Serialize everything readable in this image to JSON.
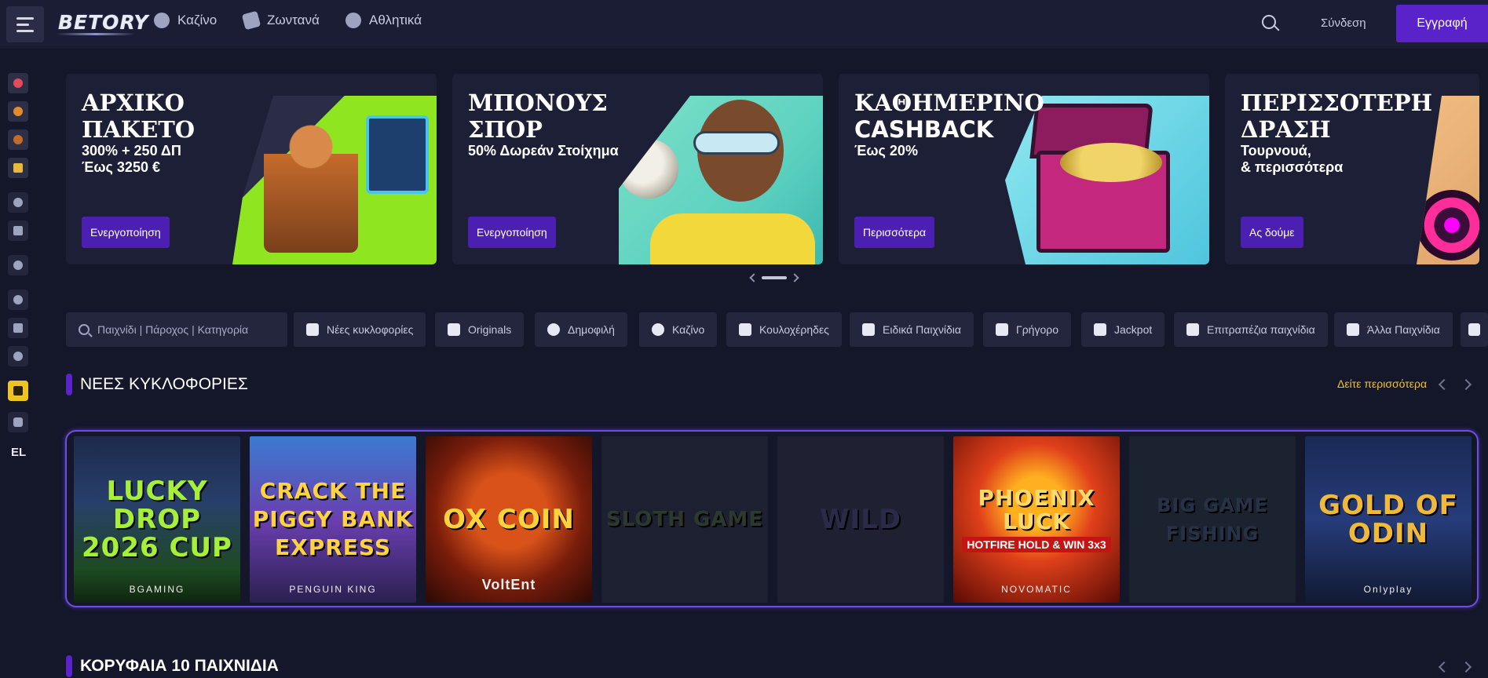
{
  "header": {
    "logo": "BETORY",
    "nav": [
      {
        "label": "Καζίνο",
        "icon": "casino-chip-icon"
      },
      {
        "label": "Ζωντανά",
        "icon": "live-dice-icon"
      },
      {
        "label": "Αθλητικά",
        "icon": "basketball-icon"
      }
    ],
    "login": "Σύνδεση",
    "register": "Εγγραφή"
  },
  "sidebar": {
    "items": [
      "crosshair-icon",
      "pizza-icon",
      "ball-icon",
      "trophy-icon",
      "casino-chip-icon",
      "dice-icon",
      "basketball-icon",
      "clock-icon",
      "crown-icon",
      "users-icon",
      "download-icon",
      "chat-icon"
    ],
    "lang": "EL"
  },
  "banners": [
    {
      "title1": "ΑΡΧΙΚΟ",
      "title2": "ΠΑΚΕΤΟ",
      "sub1": "300% + 250 ΔΠ",
      "sub2": "Έως 3250 €",
      "button": "Ενεργοποίηση"
    },
    {
      "title1": "ΜΠΟΝΟΥΣ",
      "title2": "ΣΠΟΡ",
      "sub1": "50% Δωρεάν Στοίχημα",
      "sub2": "",
      "button": "Ενεργοποίηση"
    },
    {
      "title1": "ΚΑΘΗΜΕΡΙΝΟ",
      "title2": "CASHBACK",
      "sub1": "Έως 20%",
      "sub2": "",
      "button": "Περισσότερα"
    },
    {
      "title1": "ΠΕΡΙΣΣΟΤΕΡΗ",
      "title2": "ΔΡΑΣΗ",
      "sub1": "Τουρνουά,",
      "sub2": "& περισσότερα",
      "button": "Ας δούμε"
    }
  ],
  "filters": {
    "search_placeholder": "Παιχνίδι | Πάροχος | Κατηγορία",
    "chips": [
      "Νέες κυκλοφορίες",
      "Originals",
      "Δημοφιλή",
      "Καζίνο",
      "Κουλοχέρηδες",
      "Ειδικά Παιχνίδια",
      "Γρήγορο",
      "Jackpot",
      "Επιτραπέζια παιχνίδια",
      "Άλλα Παιχνίδια"
    ]
  },
  "sections": {
    "new_releases": "ΝΕΕΣ ΚΥΚΛΟΦΟΡΙΕΣ",
    "see_more": "Δείτε περισσότερα",
    "top10": "ΚΟΡΥΦΑΙΑ 10 ΠΑΙΧΝΙΔΙΑ"
  },
  "games": [
    {
      "title": "LUCKY DROP 2026 CUP",
      "provider": "BGAMING"
    },
    {
      "title": "CRACK THE PIGGY BANK EXPRESS",
      "provider": "PENGUIN KING"
    },
    {
      "title": "OX COIN",
      "provider": "VoltEnt"
    },
    {
      "title": "SLOTH GAME",
      "provider": ""
    },
    {
      "title": "WILD",
      "provider": ""
    },
    {
      "title": "PHOENIX LUCK",
      "sub": "HOTFIRE HOLD & WIN 3x3",
      "provider": "NOVOMATIC"
    },
    {
      "title": "BIG GAME FISHING",
      "provider": ""
    },
    {
      "title": "GOLD OF ODIN",
      "provider": "Onlyplay"
    }
  ]
}
